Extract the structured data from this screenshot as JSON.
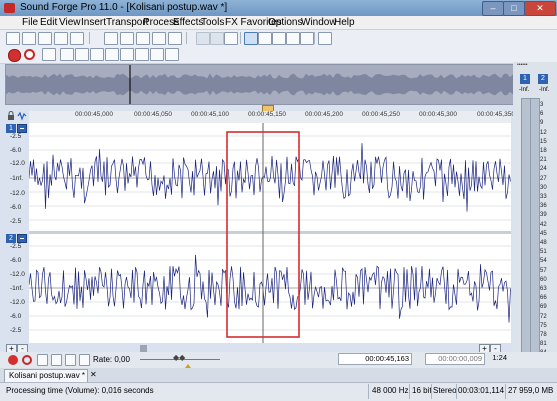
{
  "window": {
    "title": "Sound Forge Pro 11.0 - [Kolisani postup.wav *]",
    "controls": [
      "–",
      "□",
      "✕"
    ]
  },
  "menu": [
    "File",
    "Edit",
    "View",
    "Insert",
    "Transport",
    "Process",
    "Effects",
    "Tools",
    "FX Favorites",
    "Options",
    "Window",
    "Help"
  ],
  "ruler": {
    "ticks": [
      "00:00:45,000",
      "00:00:45,050",
      "00:00:45,100",
      "00:00:45,150",
      "00:00:45,200",
      "00:00:45,250",
      "00:00:45,300",
      "00:00:45,350"
    ]
  },
  "channels": [
    {
      "number": "1",
      "db_labels": [
        "-2.5",
        "-6.0",
        "-12.0",
        "-1nf.",
        "-12.0",
        "-6.0",
        "-2.5"
      ]
    },
    {
      "number": "2",
      "db_labels": [
        "-2.5",
        "-6.0",
        "-12.0",
        "-1nf.",
        "-12.0",
        "-6.0",
        "-2.5"
      ]
    }
  ],
  "vu": {
    "channels": [
      "1",
      "2"
    ],
    "top_labels": [
      "-Inf.",
      "-Inf."
    ],
    "scale": [
      "3",
      "6",
      "9",
      "12",
      "15",
      "18",
      "21",
      "24",
      "27",
      "30",
      "33",
      "36",
      "39",
      "42",
      "45",
      "48",
      "51",
      "54",
      "57",
      "60",
      "63",
      "66",
      "69",
      "72",
      "75",
      "78",
      "81",
      "84",
      "87"
    ]
  },
  "transport": {
    "rate_label": "Rate: 0,00",
    "position": "00:00:45,163",
    "length": "00:00:00,009",
    "zoom": "1:24"
  },
  "doc_tab": {
    "label": "Kolisani postup.wav *",
    "close": "✕"
  },
  "statusbar": {
    "message": "Processing time (Volume): 0,016 seconds",
    "sample_rate": "48 000 Hz",
    "bit_depth": "16 bit",
    "channels": "Stereo",
    "duration": "00:03:01,114",
    "size": "27 959,0 MB"
  },
  "colors": {
    "waveform": "#1a237e",
    "selection_box": "#d32f2f",
    "background": "#d9e2ee",
    "channel_badge": "#2e62b3"
  }
}
